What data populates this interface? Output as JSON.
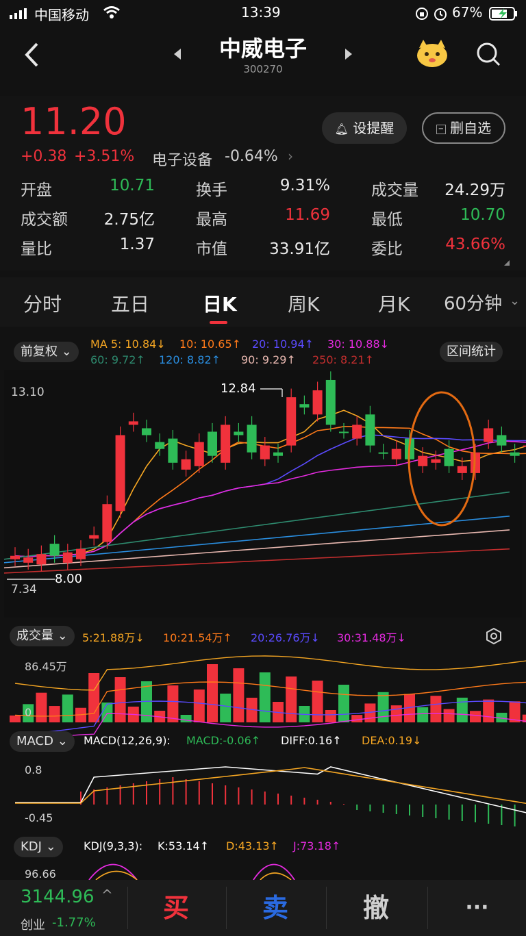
{
  "status": {
    "carrier": "中国移动",
    "time": "13:39",
    "battery": "67%"
  },
  "header": {
    "title": "中威电子",
    "code": "300270",
    "back_icon": "chevron-left-icon",
    "search_icon": "search-icon"
  },
  "quote": {
    "price": "11.20",
    "change": "+0.38",
    "change_pct": "+3.51%",
    "sector": "电子设备",
    "sector_pct": "-0.64%",
    "alert_label": "设提醒",
    "remove_label": "删自选",
    "rows": [
      [
        {
          "k": "开盘",
          "v": "10.71",
          "c": "green"
        },
        {
          "k": "换手",
          "v": "9.31%",
          "c": "white"
        },
        {
          "k": "成交量",
          "v": "24.29万",
          "c": "white"
        }
      ],
      [
        {
          "k": "成交额",
          "v": "2.75亿",
          "c": "white"
        },
        {
          "k": "最高",
          "v": "11.69",
          "c": "red"
        },
        {
          "k": "最低",
          "v": "10.70",
          "c": "green"
        }
      ],
      [
        {
          "k": "量比",
          "v": "1.37",
          "c": "white"
        },
        {
          "k": "市值",
          "v": "33.91亿",
          "c": "white"
        },
        {
          "k": "委比",
          "v": "43.66%",
          "c": "red"
        }
      ]
    ]
  },
  "tabs": [
    "分时",
    "五日",
    "日K",
    "周K",
    "月K",
    "60分钟"
  ],
  "active_tab": "日K",
  "kline": {
    "adjust_label": "前复权",
    "range_label": "区间统计",
    "ma_line1": [
      {
        "t": "MA 5: 10.84↓",
        "c": "#f5a623"
      },
      {
        "t": "10: 10.65↑",
        "c": "#ff7a1a"
      },
      {
        "t": "20: 10.94↑",
        "c": "#5b4bff"
      },
      {
        "t": "30: 10.88↓",
        "c": "#e52be0"
      }
    ],
    "ma_line2": [
      {
        "t": "60: 9.72↑",
        "c": "#2e8b6f"
      },
      {
        "t": "120: 8.82↑",
        "c": "#2a8ee0"
      },
      {
        "t": "90: 9.29↑",
        "c": "#e8b8b0"
      },
      {
        "t": "250: 8.21↑",
        "c": "#c22e2e"
      }
    ],
    "axis_high": "13.10",
    "axis_low": "7.34",
    "mark_high": "12.84",
    "mark_low": "8.00"
  },
  "volume": {
    "label": "成交量",
    "items": [
      {
        "t": "5:21.88万↓",
        "c": "#f5a623"
      },
      {
        "t": "10:21.54万↑",
        "c": "#ff7a1a"
      },
      {
        "t": "20:26.76万↓",
        "c": "#5b4bff"
      },
      {
        "t": "30:31.48万↓",
        "c": "#e52be0"
      }
    ],
    "axis_high": "86.45万",
    "axis_low": "0"
  },
  "macd": {
    "label": "MACD",
    "params": "MACD(12,26,9):",
    "items": [
      {
        "t": "MACD:-0.06↑",
        "c": "#2ebb57"
      },
      {
        "t": "DIFF:0.16↑",
        "c": "#ffffff"
      },
      {
        "t": "DEA:0.19↓",
        "c": "#f5a623"
      }
    ],
    "axis_high": "0.8",
    "axis_low": "-0.45"
  },
  "kdj": {
    "label": "KDJ",
    "params": "KDJ(9,3,3):",
    "items": [
      {
        "t": "K:53.14↑",
        "c": "#ffffff"
      },
      {
        "t": "D:43.13↑",
        "c": "#f5a623"
      },
      {
        "t": "J:73.18↑",
        "c": "#e52be0"
      }
    ],
    "axis_high": "96.66"
  },
  "bottom": {
    "index_value": "3144.96",
    "index_name": "创业",
    "index_pct": "-1.77%",
    "buy": "买",
    "sell": "卖",
    "cancel": "撤",
    "more": "···"
  }
}
